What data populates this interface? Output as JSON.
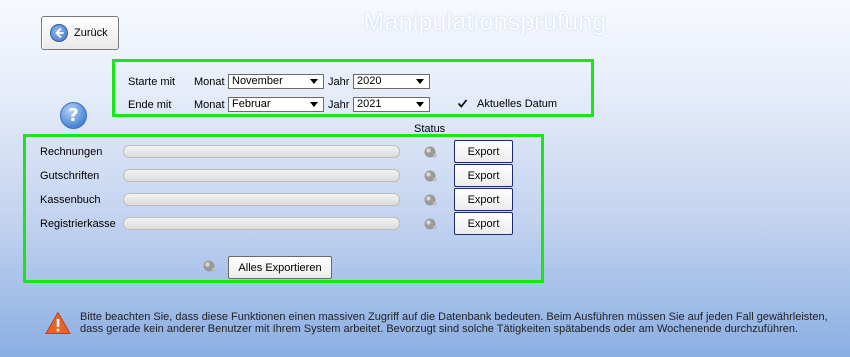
{
  "header": {
    "back_label": "Zurück",
    "title": "Manipulationsprüfung"
  },
  "range": {
    "start_label": "Starte mit",
    "end_label": "Ende mit",
    "month_label": "Monat",
    "year_label": "Jahr",
    "start_month": "November",
    "start_year": "2020",
    "end_month": "Februar",
    "end_year": "2021",
    "current_date_label": "Aktuelles Datum",
    "current_date_checked": true
  },
  "export": {
    "status_header": "Status",
    "rows": [
      {
        "label": "Rechnungen",
        "progress": 0,
        "button": "Export"
      },
      {
        "label": "Gutschriften",
        "progress": 0,
        "button": "Export"
      },
      {
        "label": "Kassenbuch",
        "progress": 0,
        "button": "Export"
      },
      {
        "label": "Registrierkasse",
        "progress": 0,
        "button": "Export"
      }
    ],
    "all_button": "Alles Exportieren"
  },
  "notice": "Bitte beachten Sie, dass diese Funktionen einen massiven Zugriff auf die Datenbank bedeuten. Beim Ausführen müssen Sie auf jeden Fall gewährleisten, dass gerade kein anderer Benutzer mit Ihrem System arbeitet. Bevorzugt sind solche Tätigkeiten spätabends oder am Wochenende durchzuführen.",
  "colors": {
    "highlight": "#19e619",
    "accent": "#3f76c6"
  }
}
